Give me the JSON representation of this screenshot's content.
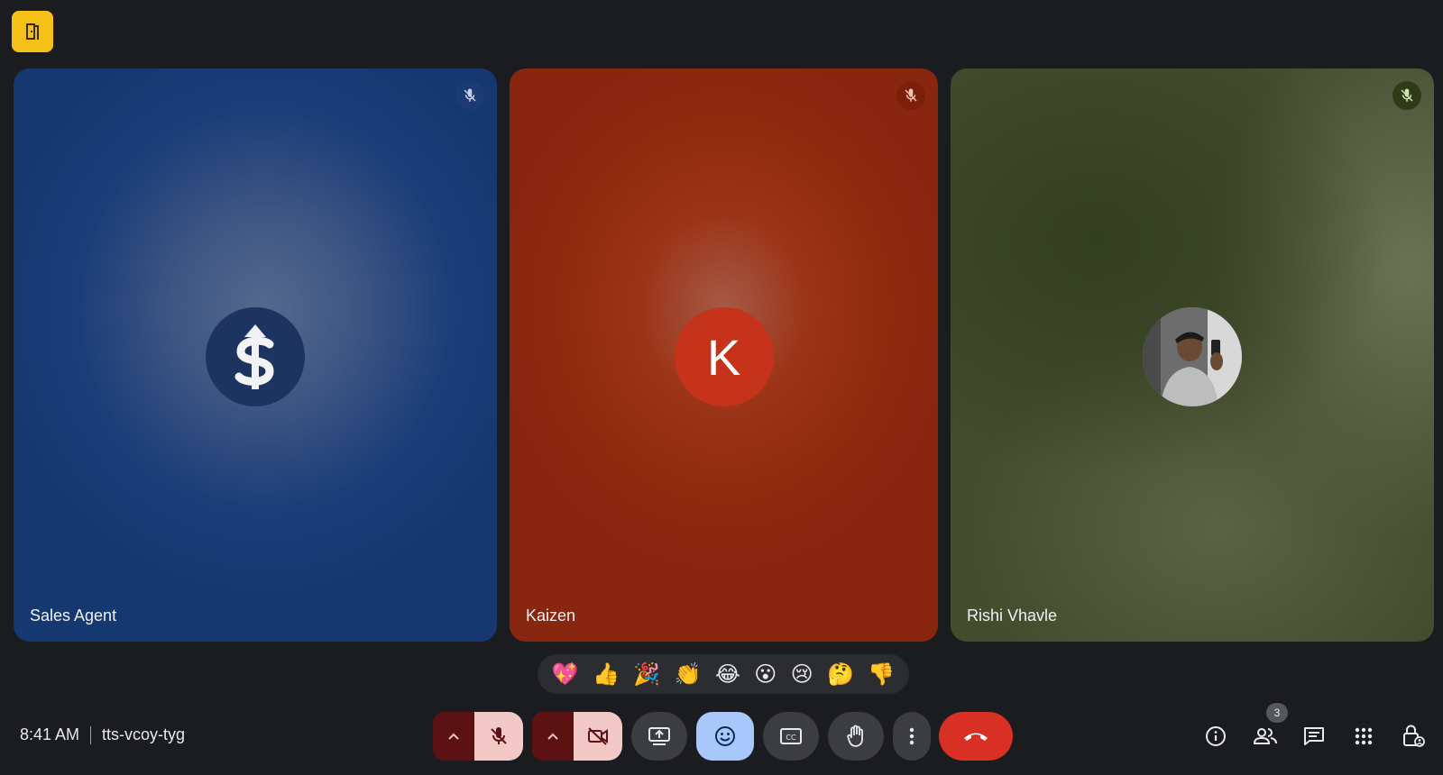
{
  "colors": {
    "accent_yellow": "#f5c118",
    "end_call": "#d93025",
    "active_blue": "#a8c7fa",
    "muted_bg": "#f2c9c6"
  },
  "participants": [
    {
      "name": "Sales Agent",
      "avatar": "dollar-arrow-logo",
      "muted": true,
      "tile_color": "#1b3d78"
    },
    {
      "name": "Kaizen",
      "avatar_letter": "K",
      "muted": true,
      "tile_color": "#8e2a0e"
    },
    {
      "name": "Rishi Vhavle",
      "avatar": "profile-photo",
      "muted": true,
      "tile_color": "#434d2e"
    }
  ],
  "reactions": [
    "💖",
    "👍",
    "🎉",
    "👏",
    "😂",
    "😮",
    "😢",
    "🤔",
    "👎"
  ],
  "meeting": {
    "time": "8:41 AM",
    "code": "tts-vcoy-tyg"
  },
  "people_count": "3",
  "icons": {
    "top_left": "door-exit-icon",
    "mic": "mic-off-icon",
    "camera": "camera-off-icon",
    "present": "present-screen-icon",
    "emoji": "emoji-icon",
    "captions": "captions-icon",
    "raise_hand": "raise-hand-icon",
    "more": "more-vert-icon",
    "end_call": "end-call-icon",
    "info": "info-icon",
    "people": "people-icon",
    "chat": "chat-icon",
    "activities": "apps-grid-icon",
    "host_controls": "lock-person-icon"
  }
}
